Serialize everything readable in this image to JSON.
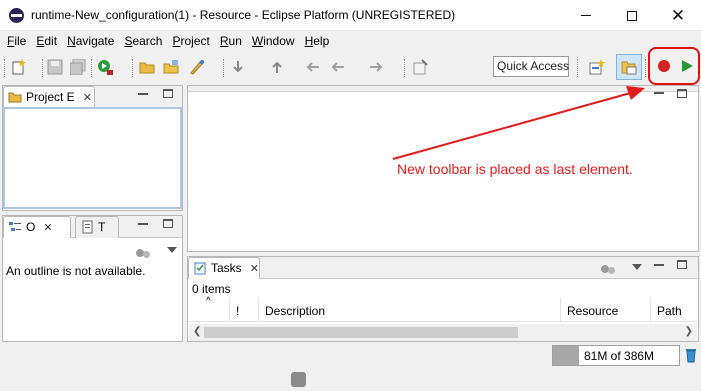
{
  "window": {
    "title": "runtime-New_configuration(1) - Resource - Eclipse Platform (UNREGISTERED)",
    "minimize": "Minimize",
    "maximize": "Maximize",
    "close": "Close"
  },
  "menu": [
    {
      "u": "F",
      "rest": "ile"
    },
    {
      "u": "E",
      "rest": "dit"
    },
    {
      "u": "N",
      "rest": "avigate"
    },
    {
      "u": "S",
      "rest": "earch"
    },
    {
      "u": "P",
      "rest": "roject"
    },
    {
      "u": "R",
      "rest": "un"
    },
    {
      "u": "W",
      "rest": "indow"
    },
    {
      "u": "H",
      "rest": "elp"
    }
  ],
  "toolbar": {
    "quick_access": "Quick Access"
  },
  "project_explorer": {
    "tab_label": "Project E"
  },
  "outline": {
    "tab_label": "O",
    "tab2_label": "T",
    "message": "An outline is not available."
  },
  "editor": {
    "annotation": "New toolbar is placed as last element."
  },
  "tasks": {
    "tab_label": "Tasks",
    "count": "0 items",
    "columns": [
      "!",
      "Description",
      "Resource",
      "Path"
    ]
  },
  "status": {
    "heap": "81M of 386M",
    "heap_fraction": 0.21
  },
  "colors": {
    "annotation": "#e31b1b",
    "record": "#d32020",
    "play": "#2a9a35"
  }
}
